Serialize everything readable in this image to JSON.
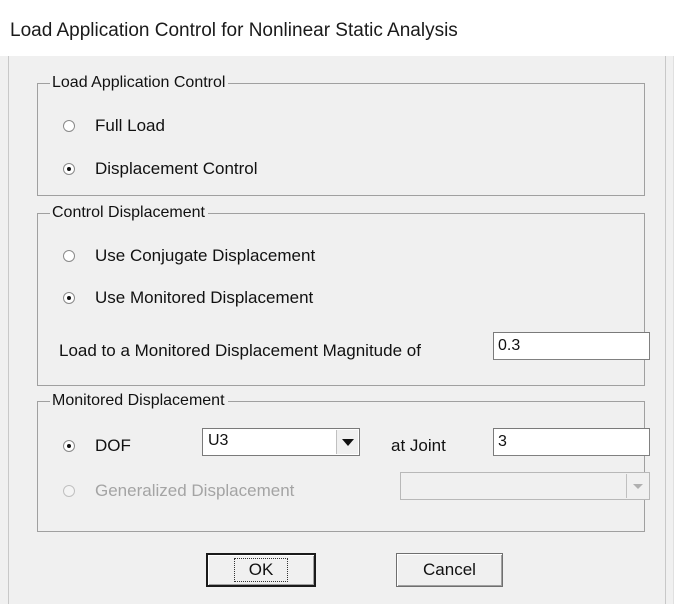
{
  "window": {
    "title": "Load Application Control for Nonlinear Static Analysis"
  },
  "load_application_control": {
    "legend": "Load Application Control",
    "options": [
      {
        "label": "Full Load",
        "checked": false,
        "enabled": true
      },
      {
        "label": "Displacement Control",
        "checked": true,
        "enabled": true
      }
    ]
  },
  "control_displacement": {
    "legend": "Control Displacement",
    "options": [
      {
        "label": "Use Conjugate Displacement",
        "checked": false,
        "enabled": true
      },
      {
        "label": "Use Monitored Displacement",
        "checked": true,
        "enabled": true
      }
    ],
    "magnitude_label": "Load to a Monitored Displacement Magnitude of",
    "magnitude_value": "0.3"
  },
  "monitored_displacement": {
    "legend": "Monitored Displacement",
    "dof": {
      "label": "DOF",
      "checked": true,
      "selected": "U3",
      "joint_label": "at Joint",
      "joint_value": "3"
    },
    "generalized": {
      "label": "Generalized Displacement",
      "checked": false,
      "enabled": false,
      "selected": ""
    }
  },
  "buttons": {
    "ok": "OK",
    "cancel": "Cancel"
  }
}
